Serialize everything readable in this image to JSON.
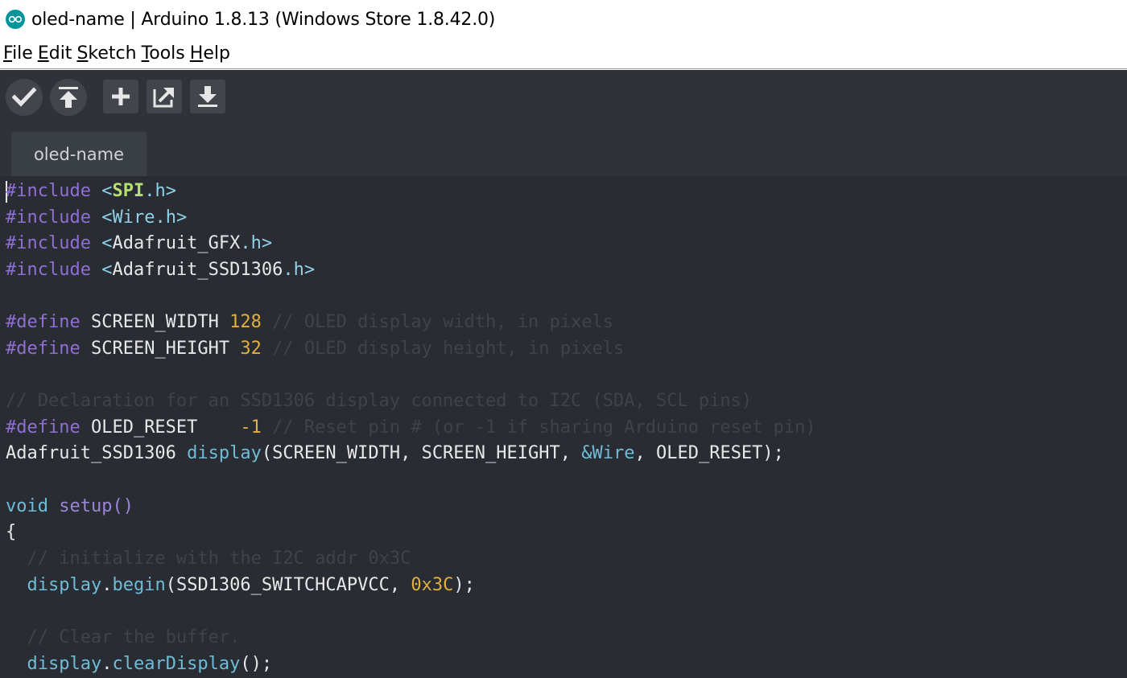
{
  "window": {
    "title": "oled-name | Arduino 1.8.13 (Windows Store 1.8.42.0)",
    "icon": "arduino-logo-icon"
  },
  "menu": [
    {
      "mnemonic": "F",
      "rest": "ile"
    },
    {
      "mnemonic": "E",
      "rest": "dit"
    },
    {
      "mnemonic": "S",
      "rest": "ketch"
    },
    {
      "mnemonic": "T",
      "rest": "ools"
    },
    {
      "mnemonic": "H",
      "rest": "elp"
    }
  ],
  "toolbar": {
    "verify": "verify-check-icon",
    "upload": "upload-arrow-icon",
    "new": "new-plus-icon",
    "open": "open-arrow-icon",
    "save": "save-download-icon"
  },
  "tabs": [
    {
      "label": "oled-name"
    }
  ],
  "editor": {
    "lines": [
      [
        {
          "t": "#include",
          "c": "pp"
        },
        {
          "t": " ",
          "c": ""
        },
        {
          "t": "<",
          "c": "lib"
        },
        {
          "t": "SPI",
          "c": "libb"
        },
        {
          "t": ".h>",
          "c": "lib"
        }
      ],
      [
        {
          "t": "#include",
          "c": "pp"
        },
        {
          "t": " ",
          "c": ""
        },
        {
          "t": "<",
          "c": "lib"
        },
        {
          "t": "Wire",
          "c": "lib"
        },
        {
          "t": ".h>",
          "c": "lib"
        }
      ],
      [
        {
          "t": "#include",
          "c": "pp"
        },
        {
          "t": " ",
          "c": ""
        },
        {
          "t": "<",
          "c": "lib"
        },
        {
          "t": "Adafruit_GFX",
          "c": ""
        },
        {
          "t": ".h>",
          "c": "lib"
        }
      ],
      [
        {
          "t": "#include",
          "c": "pp"
        },
        {
          "t": " ",
          "c": ""
        },
        {
          "t": "<",
          "c": "lib"
        },
        {
          "t": "Adafruit_SSD1306",
          "c": ""
        },
        {
          "t": ".h>",
          "c": "lib"
        }
      ],
      [],
      [
        {
          "t": "#define",
          "c": "pp"
        },
        {
          "t": " SCREEN_WIDTH ",
          "c": ""
        },
        {
          "t": "128",
          "c": "num"
        },
        {
          "t": " // OLED display width, in pixels",
          "c": "cmt"
        }
      ],
      [
        {
          "t": "#define",
          "c": "pp"
        },
        {
          "t": " SCREEN_HEIGHT ",
          "c": ""
        },
        {
          "t": "32",
          "c": "num"
        },
        {
          "t": " // OLED display height, in pixels",
          "c": "cmt"
        }
      ],
      [],
      [
        {
          "t": "// Declaration for an SSD1306 display connected to I2C (SDA, SCL pins)",
          "c": "cmt"
        }
      ],
      [
        {
          "t": "#define",
          "c": "pp"
        },
        {
          "t": " OLED_RESET    ",
          "c": ""
        },
        {
          "t": "-1",
          "c": "num"
        },
        {
          "t": " // Reset pin # (or -1 if sharing Arduino reset pin)",
          "c": "cmt"
        }
      ],
      [
        {
          "t": "Adafruit_SSD1306 ",
          "c": ""
        },
        {
          "t": "display",
          "c": "fn"
        },
        {
          "t": "(SCREEN_WIDTH, SCREEN_HEIGHT, ",
          "c": ""
        },
        {
          "t": "&Wire",
          "c": "fn"
        },
        {
          "t": ", OLED_RESET);",
          "c": ""
        }
      ],
      [],
      [
        {
          "t": "void",
          "c": "kw"
        },
        {
          "t": " ",
          "c": ""
        },
        {
          "t": "setup",
          "c": "kw2"
        },
        {
          "t": "()",
          "c": "kw2"
        }
      ],
      [
        {
          "t": "{",
          "c": ""
        }
      ],
      [
        {
          "t": "  // initialize with the I2C addr 0x3C",
          "c": "cmt"
        }
      ],
      [
        {
          "t": "  ",
          "c": ""
        },
        {
          "t": "display",
          "c": "fn"
        },
        {
          "t": ".",
          "c": ""
        },
        {
          "t": "begin",
          "c": "fn"
        },
        {
          "t": "(SSD1306_SWITCHCAPVCC, ",
          "c": ""
        },
        {
          "t": "0x3C",
          "c": "num"
        },
        {
          "t": ");",
          "c": ""
        }
      ],
      [],
      [
        {
          "t": "  // Clear the buffer.",
          "c": "cmt"
        }
      ],
      [
        {
          "t": "  ",
          "c": ""
        },
        {
          "t": "display",
          "c": "fn"
        },
        {
          "t": ".",
          "c": ""
        },
        {
          "t": "clearDisplay",
          "c": "fn"
        },
        {
          "t": "();",
          "c": ""
        }
      ]
    ]
  }
}
